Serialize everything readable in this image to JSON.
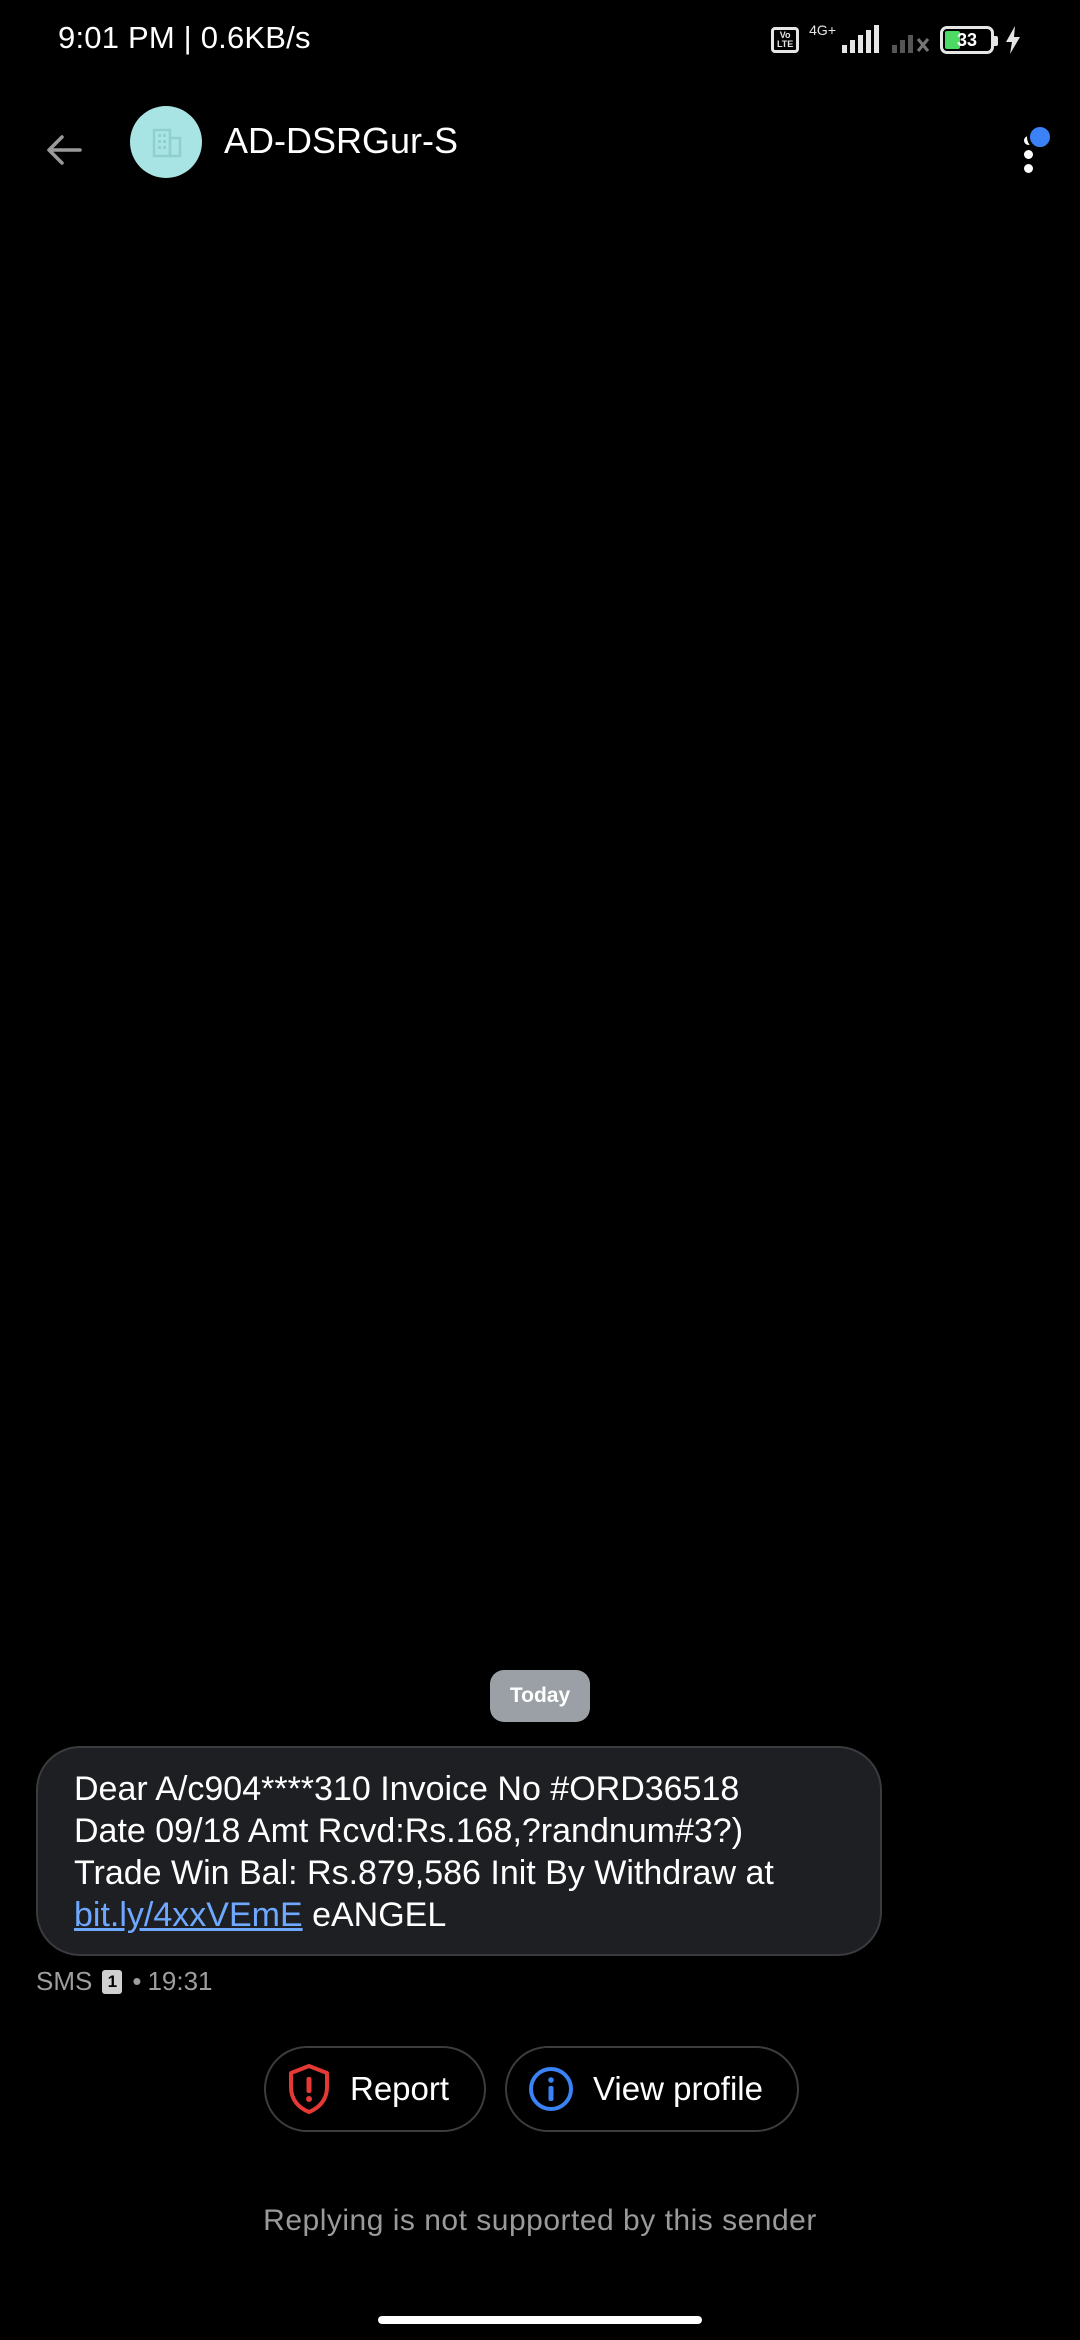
{
  "status_bar": {
    "time_speed": "9:01 PM | 0.6KB/s",
    "volte_label": "Vo LTE",
    "network_label": "4G+",
    "battery_level": "33",
    "charging_icon": "bolt-icon",
    "signal_icon": "signal-bars-icon"
  },
  "header": {
    "back_icon": "arrow-left-icon",
    "avatar_icon": "building-icon",
    "contact_name": "AD-DSRGur-S",
    "more_icon": "more-vert-icon",
    "accent_color": "#3b82f6"
  },
  "conversation": {
    "date_chip": "Today",
    "message": {
      "text_before_link": "Dear A/c904****310 Invoice No #ORD36518\nDate 09/18 Amt Rcvd:Rs.168,?randnum#3?)\nTrade Win Bal: Rs.879,586 Init By Withdraw at\n",
      "link": "bit.ly/4xxVEmE",
      "text_after_link": " eANGEL"
    },
    "meta": {
      "channel": "SMS",
      "sim": "1",
      "separator": "•",
      "time": "19:31"
    }
  },
  "actions": {
    "report_label": "Report",
    "report_icon": "shield-alert-icon",
    "report_color": "#e53935",
    "profile_label": "View profile",
    "profile_icon": "info-icon",
    "profile_color": "#3b82f6"
  },
  "footer": {
    "note": "Replying is not supported by this sender"
  }
}
